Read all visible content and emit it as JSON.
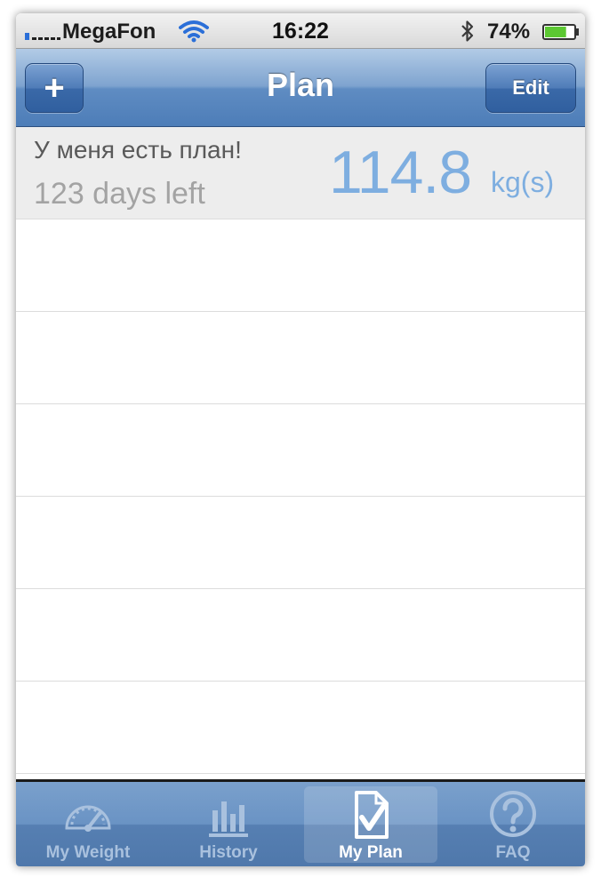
{
  "status_bar": {
    "carrier": "MegaFon",
    "time": "16:22",
    "battery_percent": "74%",
    "battery_level": 0.74,
    "icons": [
      "signal-bars-icon",
      "wifi-icon",
      "bluetooth-icon",
      "battery-icon"
    ]
  },
  "nav": {
    "title": "Plan",
    "add_label": "+",
    "edit_label": "Edit",
    "accent_color": "#5f8cc2"
  },
  "plan": {
    "name": "У меня есть план!",
    "days_left": "123 days left",
    "target_value": "114.8",
    "unit": "kg(s)",
    "value_color": "#7eaee0"
  },
  "tabs": [
    {
      "label": "My Weight",
      "icon": "speedometer-icon",
      "selected": false
    },
    {
      "label": "History",
      "icon": "bar-chart-icon",
      "selected": false
    },
    {
      "label": "My Plan",
      "icon": "document-check-icon",
      "selected": true
    },
    {
      "label": "FAQ",
      "icon": "question-circle-icon",
      "selected": false
    }
  ]
}
